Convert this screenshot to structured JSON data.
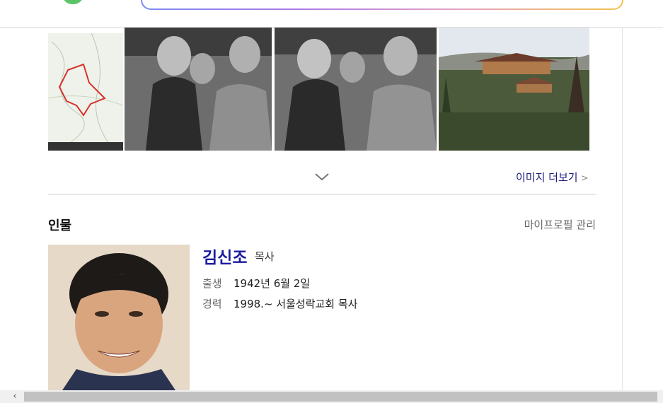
{
  "more_images": {
    "label": "이미지 더보기",
    "caret": ">"
  },
  "section": {
    "title": "인물",
    "profile_management": "마이프로필 관리"
  },
  "person": {
    "name": "김신조",
    "role": "목사",
    "rows": [
      {
        "label": "출생",
        "value": "1942년 6월 2일"
      },
      {
        "label": "경력",
        "value": "1998.~ 서울성락교회 목사"
      }
    ]
  },
  "scrollbar": {
    "left_arrow": "‹"
  },
  "colors": {
    "link_navy": "#1a1a7a",
    "name_blue": "#1a1aa0",
    "logo_green": "#5ac467"
  }
}
